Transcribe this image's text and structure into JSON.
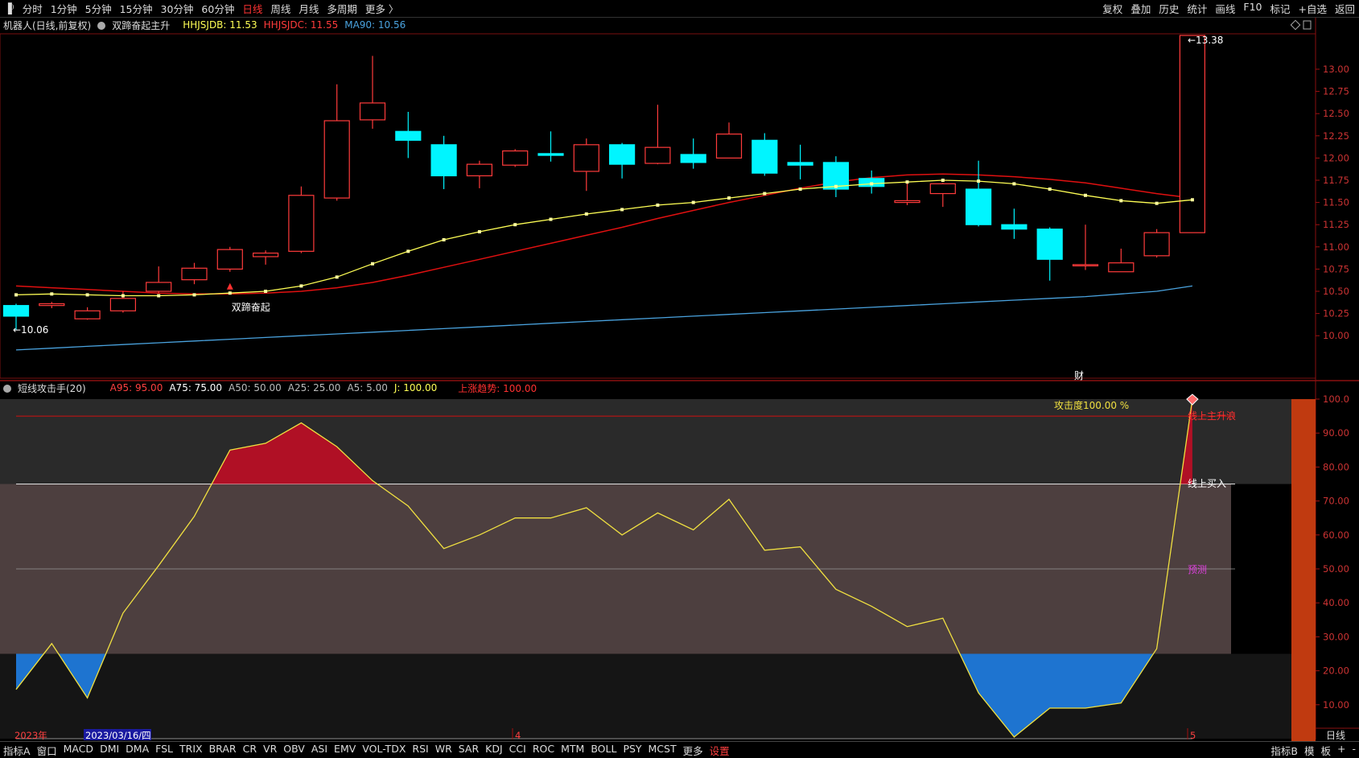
{
  "topbar": {
    "periods": [
      "分时",
      "1分钟",
      "5分钟",
      "15分钟",
      "30分钟",
      "60分钟",
      "日线",
      "周线",
      "月线",
      "多周期",
      "更多 〉"
    ],
    "active_period": "日线",
    "right_buttons": [
      "复权",
      "叠加",
      "历史",
      "统计",
      "画线",
      "F10",
      "标记",
      "+自选",
      "返回"
    ]
  },
  "main_panel": {
    "stock_label": "机器人(日线,前复权)",
    "indicator_name": "双蹄奋起主升",
    "hhjsjdb": "HHJSJDB: 11.53",
    "hhjsjdc": "HHJSJDC: 11.55",
    "ma90": "MA90: 10.56",
    "signal_label": "双蹄奋起",
    "max_label": "13.38",
    "min_label": "10.06",
    "finance_marker": "财",
    "price_axis": [
      "13.00",
      "12.75",
      "12.50",
      "12.25",
      "12.00",
      "11.75",
      "11.50",
      "11.25",
      "11.00",
      "10.75",
      "10.50",
      "10.25",
      "10.00"
    ]
  },
  "sub_panel": {
    "indicator_name": "短线攻击手(20)",
    "a95": "A95: 95.00",
    "a75": "A75: 75.00",
    "a50": "A50: 50.00",
    "a25": "A25: 25.00",
    "a5": "A5: 5.00",
    "j": "J: 100.00",
    "trend": "上涨趋势: 100.00",
    "attack_label": "攻击度100.00 %",
    "line_main": "线上主升浪",
    "line_buy": "线上买入",
    "line_forecast": "预测",
    "axis": [
      "100.0",
      "90.00",
      "80.00",
      "70.00",
      "60.00",
      "50.00",
      "40.00",
      "30.00",
      "20.00",
      "10.00"
    ]
  },
  "date_axis": {
    "year": "2023年",
    "cursor_date": "2023/03/16/四",
    "month_4": "4",
    "month_5": "5",
    "period_label": "日线"
  },
  "bottombar": {
    "left_label": "指标A",
    "tabs": [
      "窗口",
      "MACD",
      "DMI",
      "DMA",
      "FSL",
      "TRIX",
      "BRAR",
      "CR",
      "VR",
      "OBV",
      "ASI",
      "EMV",
      "VOL-TDX",
      "RSI",
      "WR",
      "SAR",
      "KDJ",
      "CCI",
      "ROC",
      "MTM",
      "BOLL",
      "PSY",
      "MCST",
      "更多",
      "设置"
    ],
    "right_labels": [
      "指标B",
      "模",
      "板",
      "+",
      "-"
    ]
  },
  "colors": {
    "up": "#ff3b3b",
    "down": "#00f5ff",
    "ma_yellow": "#ffff55",
    "ma_red": "#e01010",
    "ma90": "#4aa3df",
    "area_red": "#b01025",
    "area_blue": "#1e74d0",
    "j_line": "#f0e040"
  },
  "chart_data": [
    {
      "type": "candlestick",
      "title": "双蹄奋起主升",
      "ylim": [
        9.9,
        13.45
      ],
      "ohlc": [
        [
          10.34,
          10.36,
          10.06,
          10.22
        ],
        [
          10.34,
          10.38,
          10.31,
          10.36
        ],
        [
          10.19,
          10.32,
          10.18,
          10.28
        ],
        [
          10.28,
          10.5,
          10.26,
          10.42
        ],
        [
          10.5,
          10.78,
          10.48,
          10.6
        ],
        [
          10.63,
          10.82,
          10.58,
          10.76
        ],
        [
          10.75,
          11.0,
          10.72,
          10.97
        ],
        [
          10.89,
          10.96,
          10.8,
          10.93
        ],
        [
          10.95,
          11.68,
          10.93,
          11.58
        ],
        [
          11.55,
          12.83,
          11.52,
          12.42
        ],
        [
          12.43,
          13.15,
          12.33,
          12.62
        ],
        [
          12.3,
          12.52,
          12.0,
          12.2
        ],
        [
          12.15,
          12.25,
          11.65,
          11.8
        ],
        [
          11.8,
          11.97,
          11.66,
          11.93
        ],
        [
          11.92,
          12.1,
          11.9,
          12.08
        ],
        [
          12.05,
          12.3,
          11.96,
          12.03
        ],
        [
          11.85,
          12.22,
          11.63,
          12.15
        ],
        [
          12.15,
          12.17,
          11.77,
          11.93
        ],
        [
          11.94,
          12.6,
          11.93,
          12.12
        ],
        [
          12.04,
          12.22,
          11.88,
          11.95
        ],
        [
          12.0,
          12.4,
          12.0,
          12.27
        ],
        [
          12.2,
          12.28,
          11.8,
          11.83
        ],
        [
          11.95,
          12.15,
          11.76,
          11.92
        ],
        [
          11.95,
          12.02,
          11.56,
          11.65
        ],
        [
          11.77,
          11.86,
          11.6,
          11.68
        ],
        [
          11.5,
          11.73,
          11.47,
          11.52
        ],
        [
          11.6,
          11.72,
          11.45,
          11.71
        ],
        [
          11.65,
          11.97,
          11.23,
          11.25
        ],
        [
          11.25,
          11.43,
          11.09,
          11.2
        ],
        [
          11.2,
          11.22,
          10.62,
          10.86
        ],
        [
          10.79,
          11.25,
          10.74,
          10.8
        ],
        [
          10.72,
          10.98,
          10.72,
          10.82
        ],
        [
          10.9,
          11.2,
          10.88,
          11.16
        ],
        [
          11.16,
          13.38,
          11.16,
          13.38
        ]
      ],
      "series": [
        {
          "name": "HHJSJDB",
          "values": [
            10.46,
            10.47,
            10.46,
            10.45,
            10.45,
            10.46,
            10.48,
            10.5,
            10.56,
            10.66,
            10.81,
            10.95,
            11.08,
            11.17,
            11.25,
            11.31,
            11.37,
            11.42,
            11.47,
            11.5,
            11.55,
            11.6,
            11.65,
            11.68,
            11.71,
            11.73,
            11.75,
            11.74,
            11.71,
            11.65,
            11.58,
            11.52,
            11.49,
            11.53
          ]
        },
        {
          "name": "HHJSJDC",
          "values": [
            10.56,
            10.54,
            10.52,
            10.5,
            10.48,
            10.47,
            10.47,
            10.48,
            10.5,
            10.54,
            10.6,
            10.68,
            10.77,
            10.86,
            10.95,
            11.04,
            11.13,
            11.22,
            11.32,
            11.41,
            11.5,
            11.58,
            11.66,
            11.73,
            11.78,
            11.81,
            11.82,
            11.81,
            11.79,
            11.76,
            11.72,
            11.66,
            11.6,
            11.55
          ]
        },
        {
          "name": "MA90",
          "values": [
            9.84,
            9.86,
            9.88,
            9.9,
            9.92,
            9.94,
            9.96,
            9.98,
            10.0,
            10.02,
            10.04,
            10.06,
            10.08,
            10.1,
            10.12,
            10.14,
            10.16,
            10.18,
            10.2,
            10.22,
            10.24,
            10.26,
            10.28,
            10.3,
            10.32,
            10.34,
            10.36,
            10.38,
            10.4,
            10.42,
            10.44,
            10.47,
            10.5,
            10.56
          ]
        }
      ]
    },
    {
      "type": "line",
      "title": "短线攻击手(20)",
      "ylim": [
        0,
        100
      ],
      "series": [
        {
          "name": "J",
          "values": [
            14.5,
            28.0,
            12.0,
            37.0,
            51.0,
            65.5,
            85.0,
            87.0,
            93.0,
            86.0,
            76.0,
            68.5,
            56.0,
            60.0,
            65.0,
            65.0,
            68.0,
            60.0,
            66.5,
            61.5,
            70.5,
            55.5,
            56.5,
            44.0,
            39.0,
            33.0,
            35.5,
            13.5,
            0.5,
            9.0,
            9.0,
            10.5,
            26.5,
            100.0
          ]
        }
      ],
      "reference_lines": [
        95,
        75,
        50,
        25,
        0
      ]
    }
  ]
}
